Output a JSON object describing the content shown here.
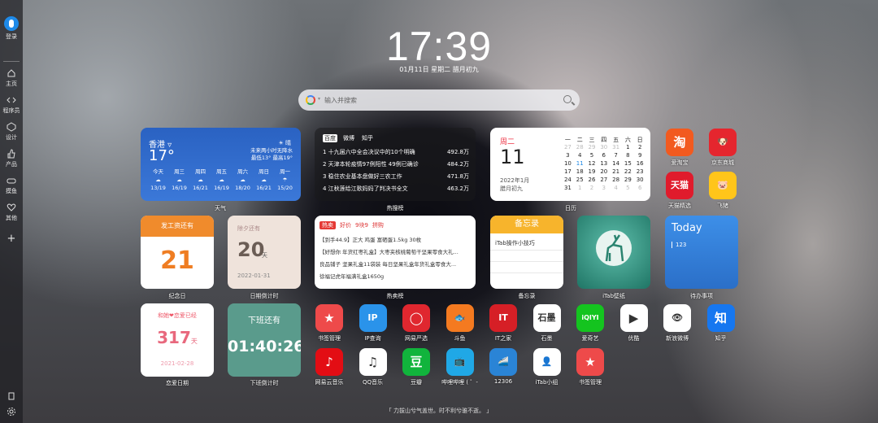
{
  "sidebar": {
    "login": "登录",
    "items": [
      {
        "label": "主页",
        "icon": "home-icon"
      },
      {
        "label": "程序员",
        "icon": "code-icon"
      },
      {
        "label": "设计",
        "icon": "design-icon"
      },
      {
        "label": "产品",
        "icon": "thumb-icon"
      },
      {
        "label": "摸鱼",
        "icon": "gamepad-icon"
      },
      {
        "label": "其他",
        "icon": "heart-icon"
      }
    ],
    "add": "+"
  },
  "clock": {
    "time": "17:39",
    "date": "01月11日 星期二 腊月初九"
  },
  "search": {
    "placeholder": "输入并搜索"
  },
  "weather": {
    "city": "香港 ▿",
    "temp": "17°",
    "cond": "☀ 晴",
    "desc1": "未来两小时无降水",
    "desc2": "最低13° 最高19°",
    "days": [
      {
        "d": "今天",
        "i": "☁",
        "t": "13/19"
      },
      {
        "d": "周三",
        "i": "☁",
        "t": "16/19"
      },
      {
        "d": "周四",
        "i": "☁",
        "t": "16/21"
      },
      {
        "d": "周五",
        "i": "☁",
        "t": "16/19"
      },
      {
        "d": "周六",
        "i": "☁",
        "t": "18/20"
      },
      {
        "d": "周日",
        "i": "☁",
        "t": "16/21"
      },
      {
        "d": "周一",
        "i": "☂",
        "t": "15/20"
      }
    ],
    "caption": "天气"
  },
  "hotlist": {
    "tabs": [
      "百度",
      "微博",
      "知乎"
    ],
    "rows": [
      {
        "t": "1  十九届六中全会决议中的10个明确",
        "v": "492.8万"
      },
      {
        "t": "2  天津本轮疫情97例阳性 49例已确诊",
        "v": "484.2万"
      },
      {
        "t": "3  稳住农业基本盘做好三农工作",
        "v": "471.8万"
      },
      {
        "t": "4  江秋莲给江歌妈妈了判决书全文",
        "v": "463.2万"
      }
    ],
    "caption": "热搜榜"
  },
  "calendar": {
    "weekday": "周二",
    "day": "11",
    "ym": "2022年1月",
    "lunar": "腊月初九",
    "head": [
      "一",
      "二",
      "三",
      "四",
      "五",
      "六",
      "日"
    ],
    "cells": [
      [
        "27",
        "m"
      ],
      [
        "28",
        "m"
      ],
      [
        "29",
        "m"
      ],
      [
        "30",
        "m"
      ],
      [
        "31",
        "m"
      ],
      [
        "1",
        ""
      ],
      [
        "2",
        ""
      ],
      [
        "3",
        ""
      ],
      [
        "4",
        ""
      ],
      [
        "5",
        ""
      ],
      [
        "6",
        ""
      ],
      [
        "7",
        ""
      ],
      [
        "8",
        ""
      ],
      [
        "9",
        ""
      ],
      [
        "10",
        ""
      ],
      [
        "11",
        "t"
      ],
      [
        "12",
        ""
      ],
      [
        "13",
        ""
      ],
      [
        "14",
        ""
      ],
      [
        "15",
        ""
      ],
      [
        "16",
        ""
      ],
      [
        "17",
        ""
      ],
      [
        "18",
        ""
      ],
      [
        "19",
        ""
      ],
      [
        "20",
        ""
      ],
      [
        "21",
        ""
      ],
      [
        "22",
        ""
      ],
      [
        "23",
        ""
      ],
      [
        "24",
        ""
      ],
      [
        "25",
        ""
      ],
      [
        "26",
        ""
      ],
      [
        "27",
        ""
      ],
      [
        "28",
        ""
      ],
      [
        "29",
        ""
      ],
      [
        "30",
        ""
      ],
      [
        "31",
        ""
      ],
      [
        "1",
        "m"
      ],
      [
        "2",
        "m"
      ],
      [
        "3",
        "m"
      ],
      [
        "4",
        "m"
      ],
      [
        "5",
        "m"
      ],
      [
        "6",
        "m"
      ]
    ],
    "caption": "日历"
  },
  "apps_right": [
    {
      "label": "爱淘宝",
      "glyph": "淘",
      "bg": "#f25a1f"
    },
    {
      "label": "京东商城",
      "glyph": "🐶",
      "bg": "#e5262e"
    },
    {
      "label": "天猫精选",
      "glyph": "天猫",
      "bg": "#e01b2c"
    },
    {
      "label": "飞猪",
      "glyph": "🐷",
      "bg": "#ffc51a"
    }
  ],
  "countdown": {
    "title": "发工资还有",
    "num": "21",
    "caption": "纪念日"
  },
  "newyear": {
    "title": "除夕还有",
    "num": "20",
    "unit": "天",
    "date": "2022-01-31",
    "caption": "日期倒计时"
  },
  "shopping": {
    "tabs": [
      "热卖",
      "好价",
      "9块9",
      "拼购"
    ],
    "rows": [
      "【到手44.9】正大 鸡蛋 富硒蛋1.5kg 30枚",
      "【好想你 年货红枣礼盒】大枣夹核桃葡萄干坚果零食大礼...",
      "良品铺子 坚果礼盒11袋装 每日坚果礼盒年货礼盒零食大...",
      "徐福记虎年福满礼盒1650g"
    ],
    "caption": "热卖榜"
  },
  "memo": {
    "title": "备忘录",
    "item": "iTab操作小技巧",
    "caption": "备忘录"
  },
  "wallpaper": {
    "caption": "iTab壁纸"
  },
  "todo": {
    "title": "Today",
    "item": "123",
    "caption": "待办事项"
  },
  "love": {
    "title": "和她❤恋爱已经",
    "num": "317",
    "unit": "天",
    "date": "2021-02-28",
    "caption": "恋爱日期"
  },
  "work": {
    "title": "下班还有",
    "num": "01:40:26",
    "caption": "下班倒计时"
  },
  "apps": [
    {
      "label": "书签管理",
      "glyph": "★",
      "bg": "#ee4a4a"
    },
    {
      "label": "IP查询",
      "glyph": "IP",
      "bg": "#2a93ea"
    },
    {
      "label": "网易严选",
      "glyph": "◯",
      "bg": "#e0272f"
    },
    {
      "label": "斗鱼",
      "glyph": "🐟",
      "bg": "#f47a20"
    },
    {
      "label": "IT之家",
      "glyph": "IT",
      "bg": "#d61f26"
    },
    {
      "label": "石墨",
      "glyph": "石墨",
      "bg": "#ffffff"
    },
    {
      "label": "爱奇艺",
      "glyph": "iQIYI",
      "bg": "#14c41f"
    },
    {
      "label": "优酷",
      "glyph": "▶",
      "bg": "#ffffff"
    },
    {
      "label": "新浪微博",
      "glyph": "👁",
      "bg": "#ffffff"
    },
    {
      "label": "知乎",
      "glyph": "知",
      "bg": "#1677f0"
    },
    {
      "label": "网易云音乐",
      "glyph": "♪",
      "bg": "#e30d14"
    },
    {
      "label": "QQ音乐",
      "glyph": "♫",
      "bg": "#ffffff"
    },
    {
      "label": "豆瓣",
      "glyph": "豆",
      "bg": "#11b43c"
    },
    {
      "label": "哔哩哔哩 ( ゜-",
      "glyph": "📺",
      "bg": "#20a8e6"
    },
    {
      "label": "12306",
      "glyph": "🚄",
      "bg": "#2a84d6"
    },
    {
      "label": "iTab小组",
      "glyph": "👤",
      "bg": "#ffffff"
    },
    {
      "label": "书签管理",
      "glyph": "★",
      "bg": "#ee4a4a"
    }
  ],
  "quote": "「 力拔山兮气盖世。时不利兮骓不逝。 」"
}
